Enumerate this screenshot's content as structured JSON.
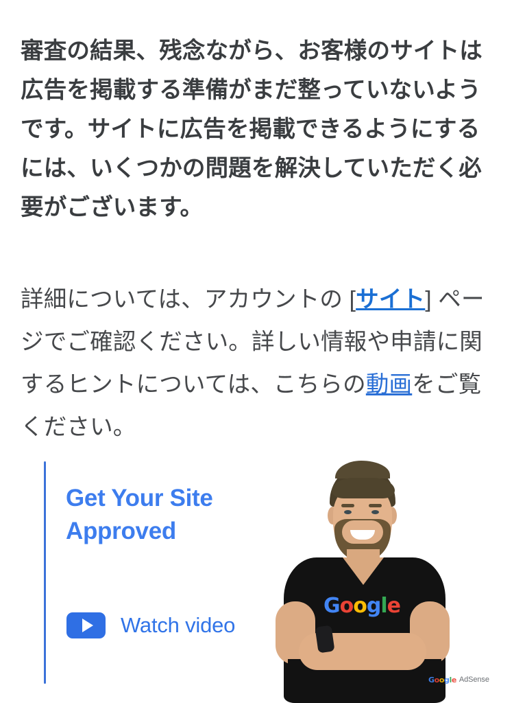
{
  "background_color": "#ffffff",
  "text_color": "#3c4043",
  "link_color": "#1a6fd4",
  "accent_blue": "#3d7dee",
  "content": {
    "lead_paragraph": {
      "full_text": "審査の結果、残念ながら、お客様のサイトは広告を掲載する準備がまだ整っていないようです。サイトに広告を掲載できるようにするには、いくつかの問題を解決していただく必要がございます。",
      "weight": "bold"
    },
    "detail_paragraph": {
      "part1": "詳細については、アカウントの ",
      "bracket_open": "[",
      "link_site": "サイト",
      "bracket_close": "]",
      "part2": " ページでご確認ください。詳しい情報や申請に関するヒントについては、こちらの",
      "link_video": "動画",
      "part3": "をご覧ください。"
    }
  },
  "promo_card": {
    "title": "Get Your Site\nApproved",
    "title_line1": "Get Your Site",
    "title_line2": "Approved",
    "watch_label": "Watch video",
    "play_icon": "play-icon",
    "rule_color": "#3b72d9",
    "title_color": "#3d7dee",
    "button_color": "#2f6fe4",
    "person_image": {
      "description": "man-with-crossed-arms-photo",
      "shirt_logo": "Google",
      "shirt_logo_letters": [
        "G",
        "o",
        "o",
        "g",
        "l",
        "e"
      ]
    },
    "brand_logo": {
      "google": "Google",
      "google_letters": [
        "G",
        "o",
        "o",
        "g",
        "l",
        "e"
      ],
      "product": "AdSense"
    }
  }
}
